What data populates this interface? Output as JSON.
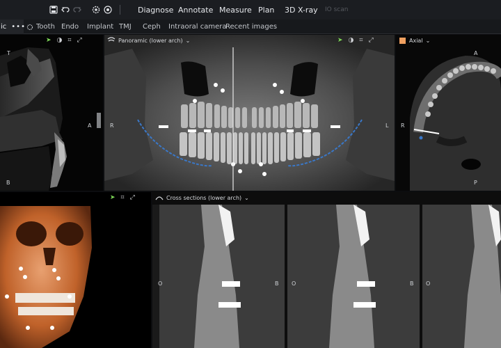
{
  "toolbar": {
    "icons": [
      "save-icon",
      "undo-icon",
      "redo-icon",
      "settings-gear-icon",
      "snapshot-icon"
    ],
    "menu": [
      "Diagnose",
      "Annotate",
      "Measure",
      "Plan",
      "3D X-ray"
    ],
    "disabled_item": "IO scan"
  },
  "tabs": {
    "current_cut": "ic",
    "current_more": "•••",
    "items": [
      "Tooth",
      "Endo",
      "Implant",
      "TMJ",
      "Ceph",
      "Intraoral camera",
      "Recent images"
    ]
  },
  "panels": {
    "sagittal": {
      "labels": {
        "top": "T",
        "right": "A",
        "bottom": "B"
      }
    },
    "panoramic": {
      "title": "Panoramic (lower arch)",
      "labels": {
        "left": "R",
        "right": "L"
      }
    },
    "axial": {
      "title": "Axial",
      "accent_color": "#f0a060",
      "labels": {
        "top": "A",
        "left": "R",
        "bottom": "P"
      }
    },
    "render3d": {},
    "cross": {
      "title": "Cross sections (lower arch)",
      "labels": [
        "O",
        "B",
        "O",
        "B",
        "O"
      ]
    }
  },
  "colors": {
    "toolbar_bg": "#1b1d21",
    "active_cursor": "#7ed957",
    "nerve_canal": "#3a78c9",
    "bone_render": "#c0622a"
  }
}
